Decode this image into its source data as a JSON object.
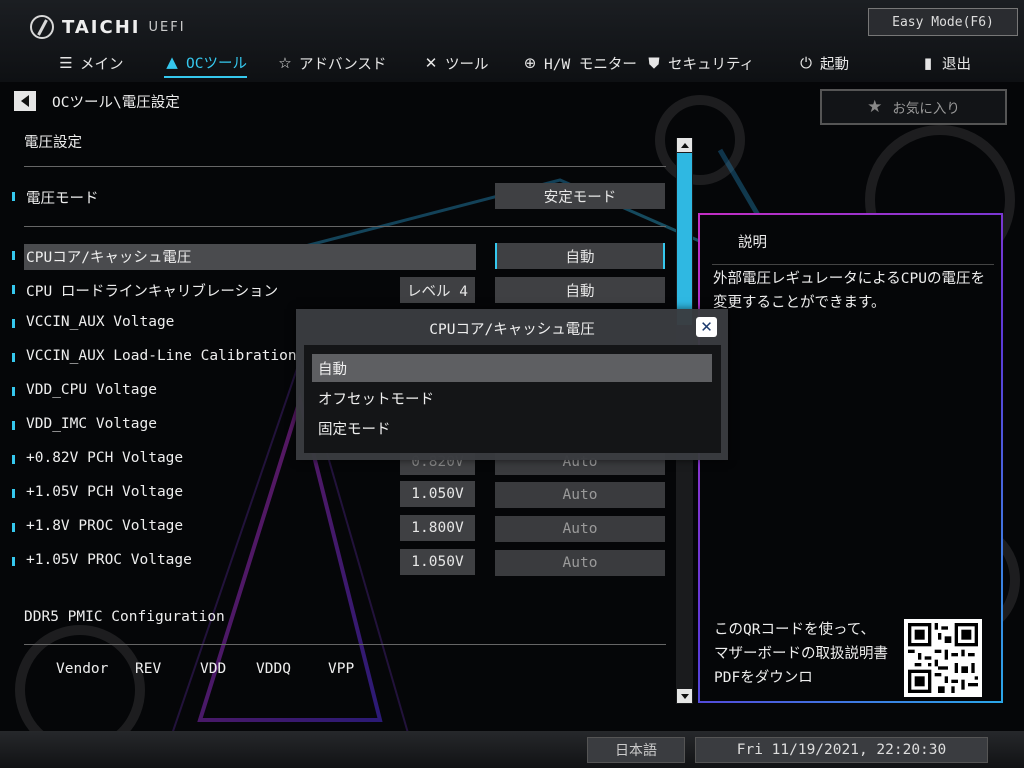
{
  "brand": {
    "name": "TAICHI",
    "sub": "UEFI"
  },
  "easy_mode_label": "Easy Mode(F6)",
  "nav": [
    {
      "icon": "list-icon",
      "label": "メイン"
    },
    {
      "icon": "rocket-icon",
      "label": "OCツール"
    },
    {
      "icon": "star-icon",
      "label": "アドバンスド"
    },
    {
      "icon": "tools-icon",
      "label": "ツール"
    },
    {
      "icon": "monitor-icon",
      "label": "H/W モニター"
    },
    {
      "icon": "shield-icon",
      "label": "セキュリティ"
    },
    {
      "icon": "power-icon",
      "label": "起動"
    },
    {
      "icon": "exit-icon",
      "label": "退出"
    }
  ],
  "active_nav": "OCツール",
  "breadcrumb": "OCツール\\電圧設定",
  "favorite_label": "お気に入り",
  "section_title": "電圧設定",
  "voltage_mode": {
    "label": "電圧モード",
    "value": "安定モード"
  },
  "rows": [
    {
      "label": "CPUコア/キャッシュ電圧",
      "level": "",
      "value": "自動"
    },
    {
      "label": "CPU ロードラインキャリブレーション",
      "level": "レベル 4",
      "value": "自動"
    },
    {
      "label": "VCCIN_AUX Voltage",
      "level": "",
      "value": ""
    },
    {
      "label": "VCCIN_AUX Load-Line Calibration",
      "level": "",
      "value": ""
    },
    {
      "label": "VDD_CPU Voltage",
      "level": "",
      "value": ""
    },
    {
      "label": "VDD_IMC Voltage",
      "level": "",
      "value": ""
    },
    {
      "label": "+0.82V PCH Voltage",
      "level": "0.820V",
      "value": "Auto"
    },
    {
      "label": "+1.05V PCH Voltage",
      "level": "1.050V",
      "value": "Auto"
    },
    {
      "label": "+1.8V PROC Voltage",
      "level": "1.800V",
      "value": "Auto"
    },
    {
      "label": "+1.05V PROC Voltage",
      "level": "1.050V",
      "value": "Auto"
    }
  ],
  "pmic": {
    "title": "DDR5 PMIC Configuration",
    "headers": [
      "Vendor",
      "REV",
      "VDD",
      "VDDQ",
      "VPP"
    ]
  },
  "description": {
    "title": "説明",
    "text": "外部電圧レギュレータによるCPUの電圧を変更することができます。",
    "qr_text": "このQRコードを使って、マザーボードの取扱説明書PDFをダウンロ"
  },
  "modal": {
    "title": "CPUコア/キャッシュ電圧",
    "options": [
      "自動",
      "オフセットモード",
      "固定モード"
    ],
    "selected": "自動"
  },
  "footer": {
    "language": "日本語",
    "datetime": "Fri 11/19/2021, 22:20:30"
  },
  "colors": {
    "accent": "#35c8ee",
    "panel_border_start": "#c42ec4",
    "panel_border_end": "#2aa7e8"
  }
}
